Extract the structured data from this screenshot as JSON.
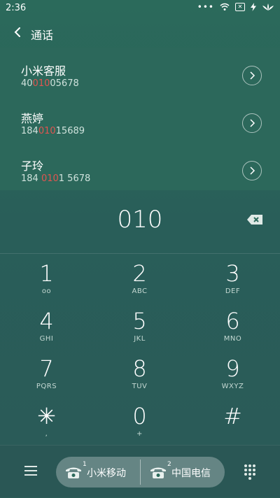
{
  "status_bar": {
    "time": "2:36",
    "dots": "•••",
    "icons": [
      "wifi-icon",
      "sim-off-icon",
      "charging-icon",
      "lotus-icon"
    ]
  },
  "header": {
    "title": "通话",
    "back_icon": "chevron-left-icon"
  },
  "results": [
    {
      "name": "小米客服",
      "number_pre": "40",
      "number_match": "010",
      "number_post": "05678"
    },
    {
      "name": "燕婷",
      "number_pre": "184",
      "number_match": "010",
      "number_post": "15689"
    },
    {
      "name": "子玲",
      "number_pre": "184 ",
      "number_match": "010",
      "number_post": "1 5678"
    }
  ],
  "dial_display": {
    "digits": "010"
  },
  "keypad": [
    {
      "num": "1",
      "sub": "oo"
    },
    {
      "num": "2",
      "sub": "ABC"
    },
    {
      "num": "3",
      "sub": "DEF"
    },
    {
      "num": "4",
      "sub": "GHI"
    },
    {
      "num": "5",
      "sub": "JKL"
    },
    {
      "num": "6",
      "sub": "MNO"
    },
    {
      "num": "7",
      "sub": "PQRS"
    },
    {
      "num": "8",
      "sub": "TUV"
    },
    {
      "num": "9",
      "sub": "WXYZ"
    },
    {
      "num": "✳",
      "sub": ","
    },
    {
      "num": "0",
      "sub": "+"
    },
    {
      "num": "#",
      "sub": ""
    }
  ],
  "bottom_bar": {
    "sim1_number": "1",
    "sim1_label": "小米移动",
    "sim2_number": "2",
    "sim2_label": "中国电信"
  },
  "colors": {
    "accent_highlight": "#e05550",
    "background": "#2b6a5b"
  }
}
